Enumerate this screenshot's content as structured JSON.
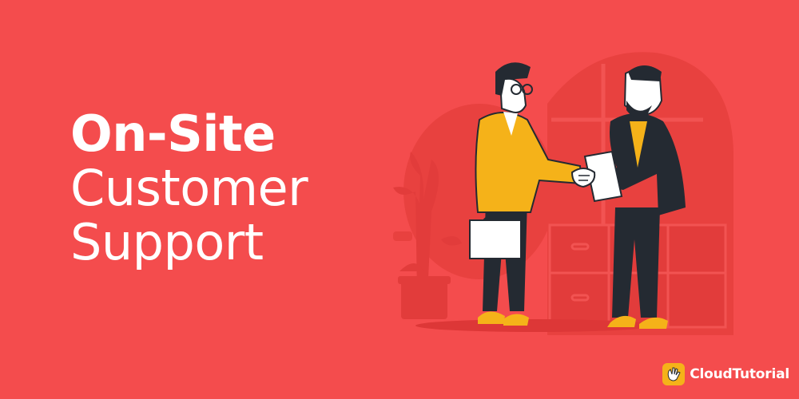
{
  "headline": {
    "line1": "On-Site",
    "line2": "Customer",
    "line3": "Support"
  },
  "brand": {
    "name": "CloudTutorial",
    "icon": "hand-wave-icon"
  },
  "illustration": {
    "subject": "two-businessmen-handshake-illustration"
  },
  "colors": {
    "background": "#f44c4d",
    "background_shape": "#e8413f",
    "jacket_yellow": "#f5b219",
    "suit_dark": "#242a32",
    "text": "#ffffff"
  }
}
